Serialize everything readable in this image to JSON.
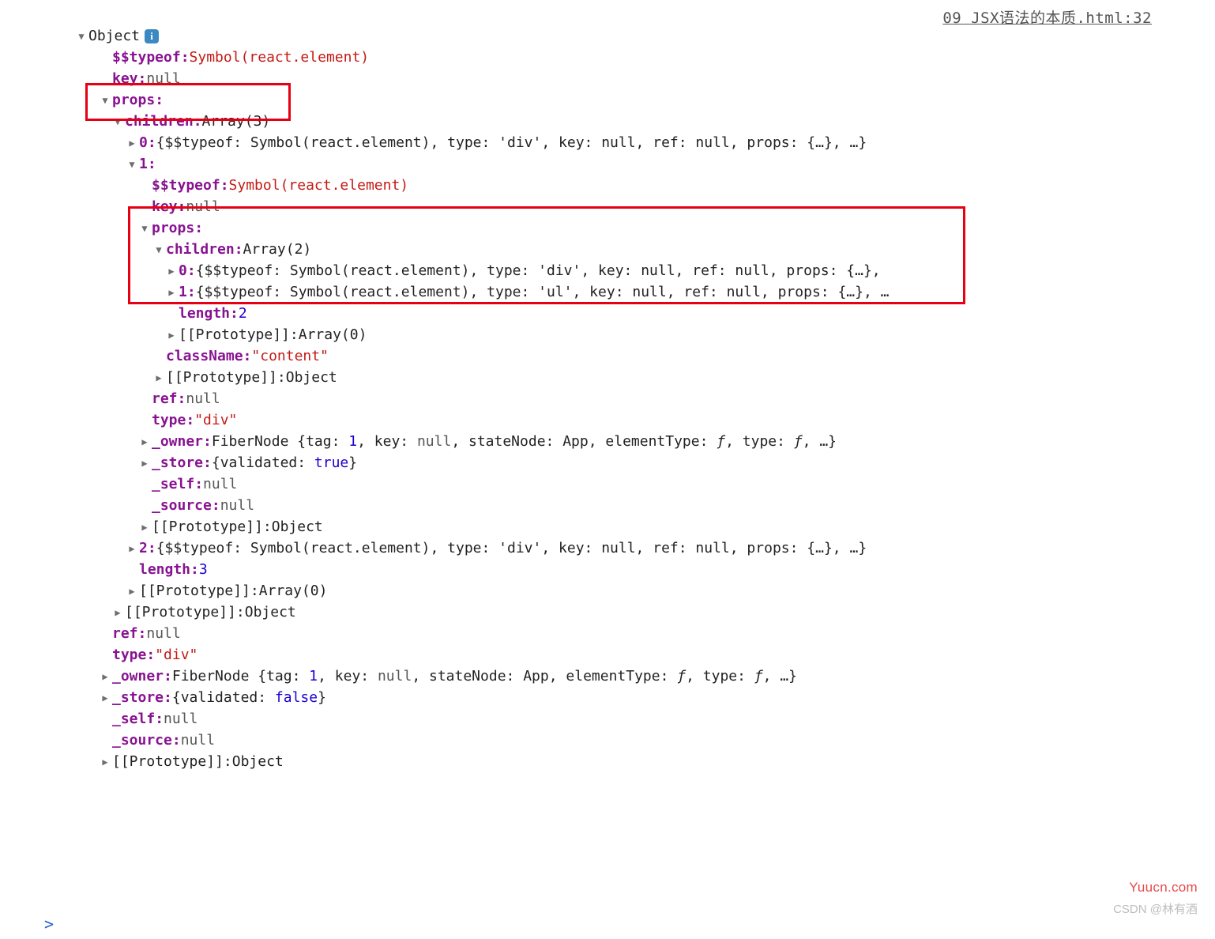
{
  "source": {
    "text": "09 JSX语法的本质.html:32"
  },
  "root": {
    "label": "Object",
    "typeof_key": "$$typeof",
    "typeof_val": "Symbol(react.element)",
    "key_label": "key",
    "key_val": "null",
    "props_label": "props",
    "children_label": "children",
    "children_type": "Array(3)",
    "child0": {
      "idx": "0",
      "summary": "{$$typeof: Symbol(react.element), type: 'div', key: null, ref: null, props: {…}, …}"
    },
    "child1": {
      "idx": "1",
      "typeof_key": "$$typeof",
      "typeof_val": "Symbol(react.element)",
      "key_label": "key",
      "key_val": "null",
      "props_label": "props",
      "children_label": "children",
      "children_type": "Array(2)",
      "c0": {
        "idx": "0",
        "summary": "{$$typeof: Symbol(react.element), type: 'div', key: null, ref: null, props: {…},"
      },
      "c1": {
        "idx": "1",
        "summary": "{$$typeof: Symbol(react.element), type: 'ul', key: null, ref: null, props: {…}, …"
      },
      "length_key": "length",
      "length_val": "2",
      "proto_label": "[[Prototype]]",
      "proto_val": "Array(0)",
      "className_key": "className",
      "className_val": "\"content\"",
      "proto2_label": "[[Prototype]]",
      "proto2_val": "Object",
      "ref_label": "ref",
      "ref_val": "null",
      "type_label": "type",
      "type_val": "\"div\"",
      "owner_label": "_owner",
      "owner_val_pre": "FiberNode {tag: ",
      "owner_tag": "1",
      "owner_mid1": ", key: ",
      "owner_keyv": "null",
      "owner_mid2": ", stateNode: App, elementType: ",
      "owner_f1": "ƒ",
      "owner_mid3": ", type: ",
      "owner_f2": "ƒ",
      "owner_end": ", …}",
      "store_label": "_store",
      "store_pre": "{validated: ",
      "store_val": "true",
      "store_end": "}",
      "self_label": "_self",
      "self_val": "null",
      "source_label": "_source",
      "source_val": "null",
      "proto3_label": "[[Prototype]]",
      "proto3_val": "Object"
    },
    "child2": {
      "idx": "2",
      "summary": "{$$typeof: Symbol(react.element), type: 'div', key: null, ref: null, props: {…}, …}"
    },
    "length_key": "length",
    "length_val": "3",
    "proto_arr_label": "[[Prototype]]",
    "proto_arr_val": "Array(0)",
    "proto_obj_label": "[[Prototype]]",
    "proto_obj_val": "Object",
    "ref_label": "ref",
    "ref_val": "null",
    "type_label": "type",
    "type_val": "\"div\"",
    "owner_label": "_owner",
    "owner_val_pre": "FiberNode {tag: ",
    "owner_tag": "1",
    "owner_mid1": ", key: ",
    "owner_keyv": "null",
    "owner_mid2": ", stateNode: App, elementType: ",
    "owner_f1": "ƒ",
    "owner_mid3": ", type: ",
    "owner_f2": "ƒ",
    "owner_end": ", …}",
    "store_label": "_store",
    "store_pre": "{validated: ",
    "store_val": "false",
    "store_end": "}",
    "self_label": "_self",
    "self_val": "null",
    "source_label": "_source",
    "source_val": "null",
    "proto_last_label": "[[Prototype]]",
    "proto_last_val": "Object"
  },
  "watermark_right": "Yuucn.com",
  "watermark_bottom": "CSDN @林有酒",
  "prompt": ">"
}
